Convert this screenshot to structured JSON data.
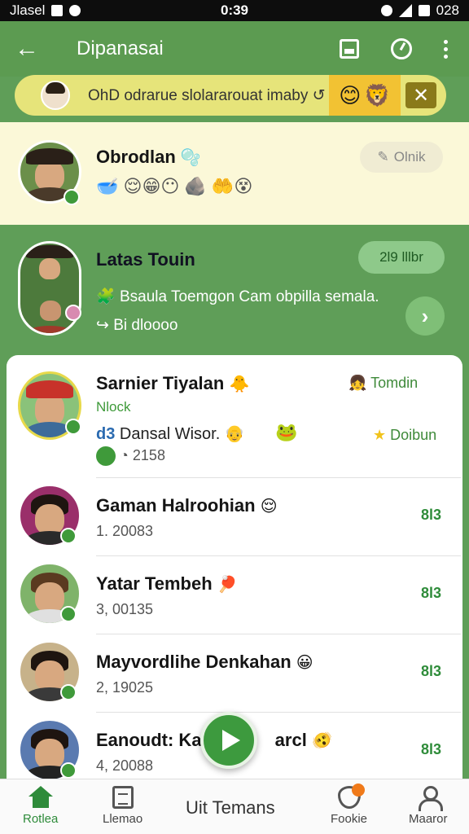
{
  "status_bar": {
    "left_text": "Jlasel",
    "time": "0:39",
    "right_text": "028"
  },
  "app_bar": {
    "title": "Dipanasai"
  },
  "banner": {
    "text": "OhD odrarue slolararouat imaby ↺",
    "emojis": [
      "😊",
      "🦁"
    ],
    "close": "✕"
  },
  "chats": {
    "pinned_top": {
      "name": "Obrodlan",
      "name_emoji": "🫧",
      "emoji_row": "🥣 😌😁😶 🪨 🤲😵",
      "pill": "Olnik",
      "pill_icon": "✎"
    },
    "pinned_green": {
      "name": "Latas Touin",
      "pill": "2l9 lllbr",
      "message": "Bsaula Toemgon Cam obpilla semala.",
      "message_emoji": "🧩",
      "sub": "Bi dloooo",
      "sub_icon": "↪"
    },
    "highlighted": {
      "name": "Sarnier Tiyalan",
      "name_emoji": "🐥",
      "tag": "Nlock",
      "message": "Dansal Wisor.",
      "message_prefix": "d3",
      "message_emoji": "👴",
      "extra_emoji": "🐸",
      "count": "2158",
      "right_label": "Tomdin",
      "right_emoji": "👧",
      "star_label": "Doibun"
    },
    "rows": [
      {
        "name": "Gaman Halroohian",
        "emoji": "😌",
        "sub": "1. 20083",
        "count": "8l3"
      },
      {
        "name": "Yatar Tembeh",
        "emoji": "🏓",
        "sub": "3, 00135",
        "count": "8l3"
      },
      {
        "name": "Mayvordlihe Denkahan",
        "emoji": "😀",
        "sub": "2, 19025",
        "count": "8l3"
      },
      {
        "name": "Eanoudt: Kal",
        "name_tail": "arcl",
        "emoji": "🫨",
        "sub": "4, 20088",
        "count": "8l3"
      }
    ]
  },
  "bottom_nav": {
    "items": [
      {
        "label": "Rotlea",
        "icon": "home-icon"
      },
      {
        "label": "Llemao",
        "icon": "document-icon"
      },
      {
        "label": "Fookie",
        "icon": "shield-icon"
      },
      {
        "label": "Maaror",
        "icon": "person-icon"
      }
    ],
    "center_label": "Uit Temans"
  },
  "colors": {
    "primary": "#5c9b51",
    "accent": "#2e8b3a",
    "banner": "#e6e47a",
    "pinned_bg": "#fbf8d8"
  }
}
